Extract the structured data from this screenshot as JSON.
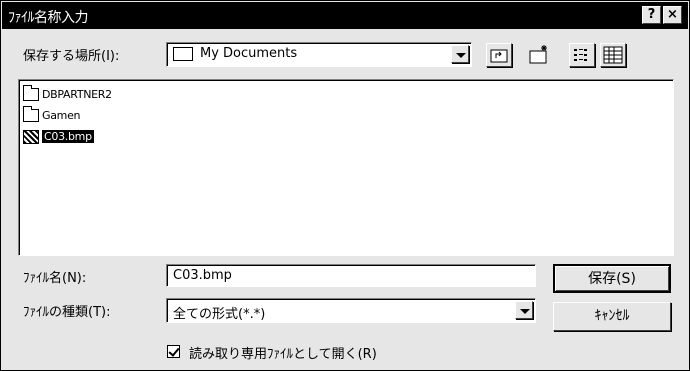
{
  "dialog": {
    "title": "ﾌｧｲﾙ名称入力",
    "help_label": "?",
    "close_label": "×"
  },
  "location": {
    "label": "保存する場所(I):",
    "value": "My Documents"
  },
  "toolbar": {
    "icons": [
      "up-folder-icon",
      "new-folder-icon",
      "list-view-icon",
      "details-view-icon"
    ]
  },
  "files": [
    {
      "name": "DBPARTNER2",
      "type": "folder",
      "selected": false
    },
    {
      "name": "Gamen",
      "type": "folder",
      "selected": false
    },
    {
      "name": "C03.bmp",
      "type": "bitmap",
      "selected": true
    }
  ],
  "filename": {
    "label": "ﾌｧｲﾙ名(N):",
    "value": "C03.bmp"
  },
  "filetype": {
    "label": "ﾌｧｲﾙの種類(T):",
    "value": "全ての形式(*.*)"
  },
  "buttons": {
    "save": "保存(S)",
    "cancel": "ｷｬﾝｾﾙ"
  },
  "readonly": {
    "label": "読み取り専用ﾌｧｲﾙとして開く(R)",
    "checked": true
  }
}
